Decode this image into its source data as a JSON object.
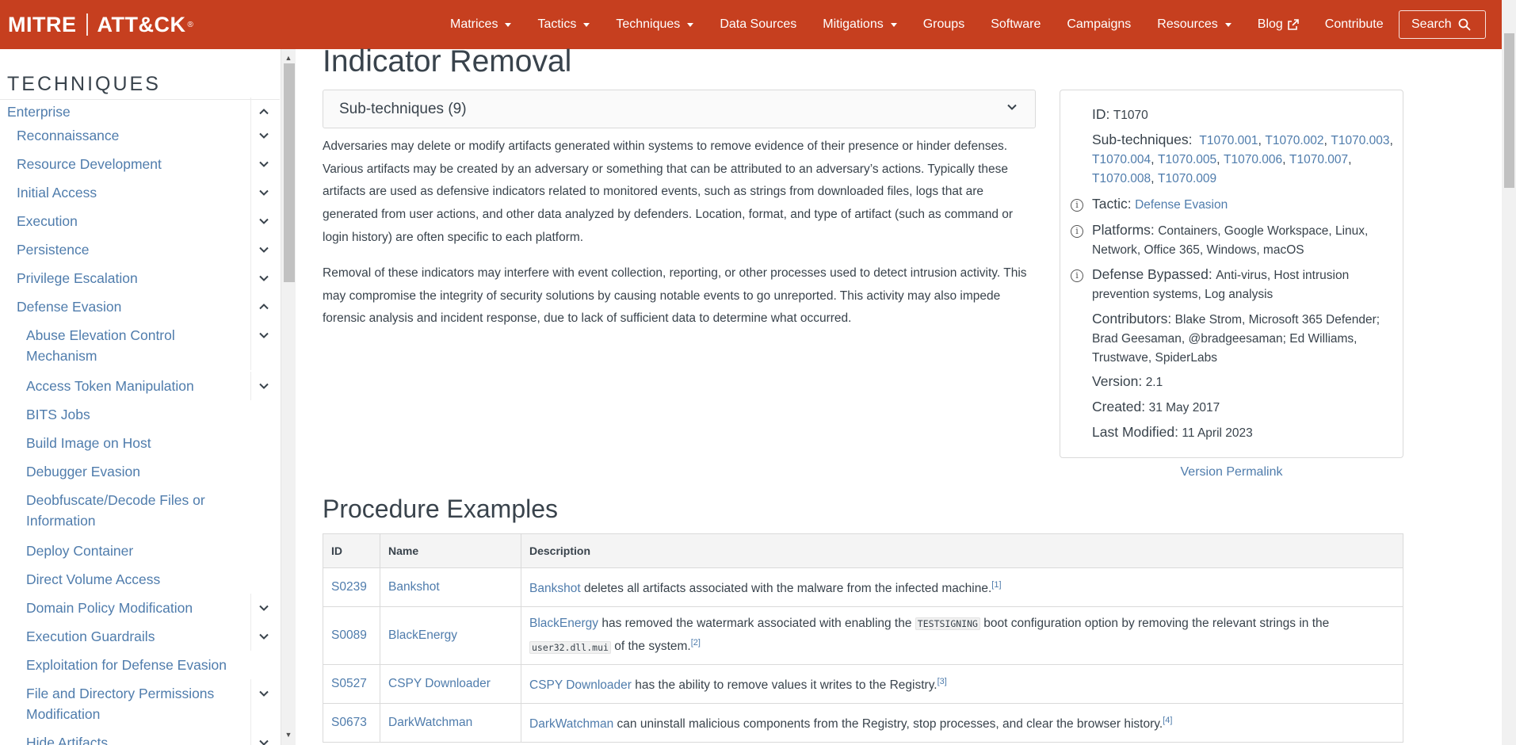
{
  "header": {
    "brand_left": "MITRE",
    "brand_right": "ATT&CK",
    "brand_tm": "®",
    "nav": [
      {
        "label": "Matrices",
        "dropdown": true
      },
      {
        "label": "Tactics",
        "dropdown": true
      },
      {
        "label": "Techniques",
        "dropdown": true
      },
      {
        "label": "Data Sources",
        "dropdown": false
      },
      {
        "label": "Mitigations",
        "dropdown": true
      },
      {
        "label": "Groups",
        "dropdown": false
      },
      {
        "label": "Software",
        "dropdown": false
      },
      {
        "label": "Campaigns",
        "dropdown": false
      },
      {
        "label": "Resources",
        "dropdown": true
      },
      {
        "label": "Blog",
        "dropdown": false,
        "external": true
      },
      {
        "label": "Contribute",
        "dropdown": false
      }
    ],
    "search_label": "Search",
    "accent_color": "#c63f1f"
  },
  "sidebar": {
    "title": "TECHNIQUES",
    "items": [
      {
        "label": "Enterprise",
        "chevron": "up"
      },
      {
        "label": "Reconnaissance",
        "chevron": "down"
      },
      {
        "label": "Resource Development",
        "chevron": "down"
      },
      {
        "label": "Initial Access",
        "chevron": "down"
      },
      {
        "label": "Execution",
        "chevron": "down"
      },
      {
        "label": "Persistence",
        "chevron": "down"
      },
      {
        "label": "Privilege Escalation",
        "chevron": "down"
      },
      {
        "label": "Defense Evasion",
        "chevron": "up"
      },
      {
        "label": "Abuse Elevation Control",
        "label2": "Mechanism",
        "chevron": "down"
      },
      {
        "label": "Access Token Manipulation",
        "chevron": "down"
      },
      {
        "label": "BITS Jobs",
        "chevron": ""
      },
      {
        "label": "Build Image on Host",
        "chevron": ""
      },
      {
        "label": "Debugger Evasion",
        "chevron": ""
      },
      {
        "label": "Deobfuscate/Decode Files or",
        "label2": "Information",
        "chevron": ""
      },
      {
        "label": "Deploy Container",
        "chevron": ""
      },
      {
        "label": "Direct Volume Access",
        "chevron": ""
      },
      {
        "label": "Domain Policy Modification",
        "chevron": "down"
      },
      {
        "label": "Execution Guardrails",
        "chevron": "down"
      },
      {
        "label": "Exploitation for Defense Evasion",
        "chevron": ""
      },
      {
        "label": "File and Directory Permissions",
        "label2": "Modification",
        "chevron": "down"
      },
      {
        "label": "Hide Artifacts",
        "chevron": "down"
      }
    ]
  },
  "main": {
    "title": "Indicator Removal",
    "subtechniques_label": "Sub-techniques (9)",
    "description": [
      "Adversaries may delete or modify artifacts generated within systems to remove evidence of their presence or hinder defenses. Various artifacts may be created by an adversary or something that can be attributed to an adversary’s actions. Typically these artifacts are used as defensive indicators related to monitored events, such as strings from downloaded files, logs that are generated from user actions, and other data analyzed by defenders. Location, format, and type of artifact (such as command or login history) are often specific to each platform.",
      "Removal of these indicators may interfere with event collection, reporting, or other processes used to detect intrusion activity. This may compromise the integrity of security solutions by causing notable events to go unreported. This activity may also impede forensic analysis and incident response, due to lack of sufficient data to determine what occurred."
    ]
  },
  "info_card": {
    "id_key": "ID:",
    "id_value": "T1070",
    "subtech_key": "Sub-techniques:",
    "subtech_links": [
      "T1070.001",
      "T1070.002",
      "T1070.003",
      "T1070.004",
      "T1070.005",
      "T1070.006",
      "T1070.007",
      "T1070.008",
      "T1070.009"
    ],
    "tactic_key": "Tactic:",
    "tactic_value": "Defense Evasion",
    "platforms_key": "Platforms:",
    "platforms_value": "Containers, Google Workspace, Linux, Network, Office 365, Windows, macOS",
    "bypassed_key": "Defense Bypassed:",
    "bypassed_value": "Anti-virus, Host intrusion prevention systems, Log analysis",
    "contributors_key": "Contributors:",
    "contributors_value": "Blake Strom, Microsoft 365 Defender; Brad Geesaman, @bradgeesaman; Ed Williams, Trustwave, SpiderLabs",
    "version_key": "Version:",
    "version_value": "2.1",
    "created_key": "Created:",
    "created_value": "31 May 2017",
    "modified_key": "Last Modified:",
    "modified_value": "11 April 2023",
    "info_glyph": "i",
    "permalink": "Version Permalink"
  },
  "procedures": {
    "title": "Procedure Examples",
    "columns": [
      "ID",
      "Name",
      "Description"
    ],
    "rows": [
      {
        "id": "S0239",
        "name": "Bankshot",
        "desc_link": "Bankshot",
        "desc_a": " deletes all artifacts associated with the malware from the infected machine.",
        "ref": "[1]"
      },
      {
        "id": "S0089",
        "name": "BlackEnergy",
        "desc_link": "BlackEnergy",
        "desc_a": " has removed the watermark associated with enabling the ",
        "code1": "TESTSIGNING",
        "desc_b": " boot configuration option by removing the relevant strings in the ",
        "code2": "user32.dll.mui",
        "desc_c": " of the system.",
        "ref": "[2]"
      },
      {
        "id": "S0527",
        "name": "CSPY Downloader",
        "desc_link": "CSPY Downloader",
        "desc_a": " has the ability to remove values it writes to the Registry.",
        "ref": "[3]"
      },
      {
        "id": "S0673",
        "name": "DarkWatchman",
        "desc_link": "DarkWatchman",
        "desc_a": " can uninstall malicious components from the Registry, stop processes, and clear the browser history.",
        "ref": "[4]"
      }
    ]
  }
}
